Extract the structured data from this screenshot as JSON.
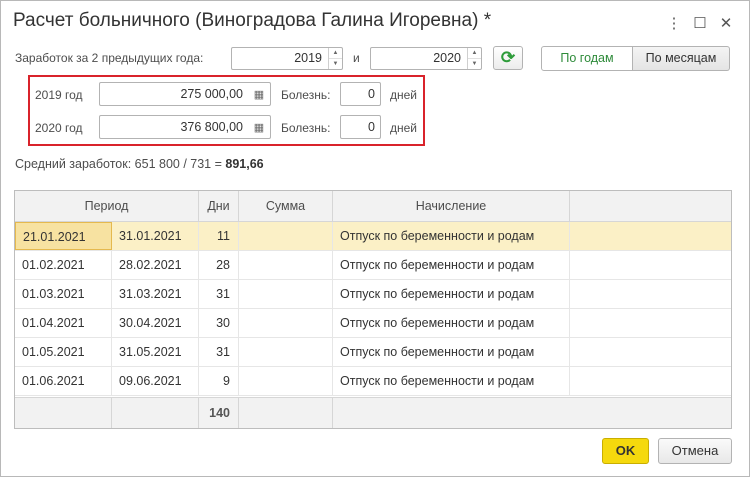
{
  "window": {
    "title": "Расчет больничного (Виноградова Галина Игоревна) *",
    "more_glyph": "⋮",
    "maximize_glyph": "☐",
    "close_glyph": "✕"
  },
  "earnings": {
    "label": "Заработок за 2 предыдущих года:",
    "year_from": "2019",
    "and_label": "и",
    "year_to": "2020",
    "refresh_glyph": "⟳",
    "by_years_label": "По годам",
    "by_months_label": "По месяцам"
  },
  "years": [
    {
      "year_label": "2019 год",
      "amount": "275 000,00",
      "illness_label": "Болезнь:",
      "illness_days": "0",
      "days_label": "дней"
    },
    {
      "year_label": "2020 год",
      "amount": "376 800,00",
      "illness_label": "Болезнь:",
      "illness_days": "0",
      "days_label": "дней"
    }
  ],
  "average": {
    "prefix": "Средний заработок: 651 800 / 731 =",
    "value": "891,66"
  },
  "table": {
    "headers": {
      "period": "Период",
      "days": "Дни",
      "sum": "Сумма",
      "accrual": "Начисление"
    },
    "rows": [
      {
        "from": "21.01.2021",
        "to": "31.01.2021",
        "days": "11",
        "sum": "",
        "accrual": "Отпуск по беременности и родам"
      },
      {
        "from": "01.02.2021",
        "to": "28.02.2021",
        "days": "28",
        "sum": "",
        "accrual": "Отпуск по беременности и родам"
      },
      {
        "from": "01.03.2021",
        "to": "31.03.2021",
        "days": "31",
        "sum": "",
        "accrual": "Отпуск по беременности и родам"
      },
      {
        "from": "01.04.2021",
        "to": "30.04.2021",
        "days": "30",
        "sum": "",
        "accrual": "Отпуск по беременности и родам"
      },
      {
        "from": "01.05.2021",
        "to": "31.05.2021",
        "days": "31",
        "sum": "",
        "accrual": "Отпуск по беременности и родам"
      },
      {
        "from": "01.06.2021",
        "to": "09.06.2021",
        "days": "9",
        "sum": "",
        "accrual": "Отпуск по беременности и родам"
      }
    ],
    "total_days": "140"
  },
  "buttons": {
    "ok": "OK",
    "cancel": "Отмена"
  },
  "colors": {
    "accent_green": "#2e8b3a",
    "highlight_red": "#d9232b",
    "ok_yellow": "#f5d90d",
    "selected_row": "#fbf0c6"
  }
}
